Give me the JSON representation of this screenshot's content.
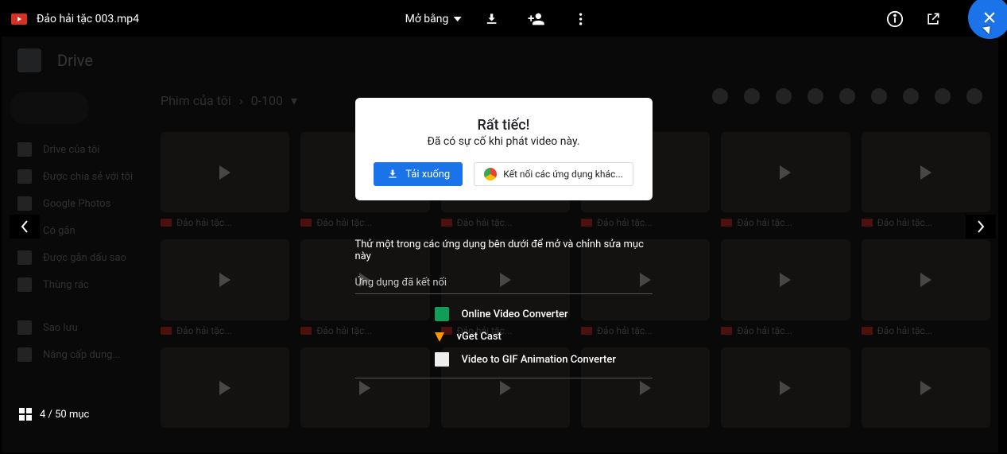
{
  "header": {
    "file_name": "Đảo hải tặc 003.mp4",
    "open_with": "Mở bằng"
  },
  "modal": {
    "title": "Rất tiếc!",
    "subtitle": "Đã có sự cố khi phát video này.",
    "download": "Tải xuống",
    "connect_apps": "Kết nối các ứng dụng khác..."
  },
  "apps": {
    "heading": "Thử một trong các ứng dụng bên dưới để mở và chỉnh sửa mục này",
    "connected_label": "Ứng dụng đã kết nối",
    "items": [
      {
        "name": "Online Video Converter"
      },
      {
        "name": "vGet Cast"
      },
      {
        "name": "Video to GIF Animation Converter"
      }
    ]
  },
  "drive": {
    "app_name": "Drive",
    "breadcrumb1": "Phim của tôi",
    "breadcrumb2": "0-100",
    "sidebar": {
      "items": [
        "Drive của tôi",
        "Được chia sẻ với tôi",
        "Google Photos",
        "Có gắn",
        "Được gắn dấu sao",
        "Thùng rác"
      ]
    },
    "storage_label": "Sao lưu",
    "upgrades": "Nâng cấp dung..."
  },
  "footer": {
    "counter": "4 / 50 mục"
  }
}
